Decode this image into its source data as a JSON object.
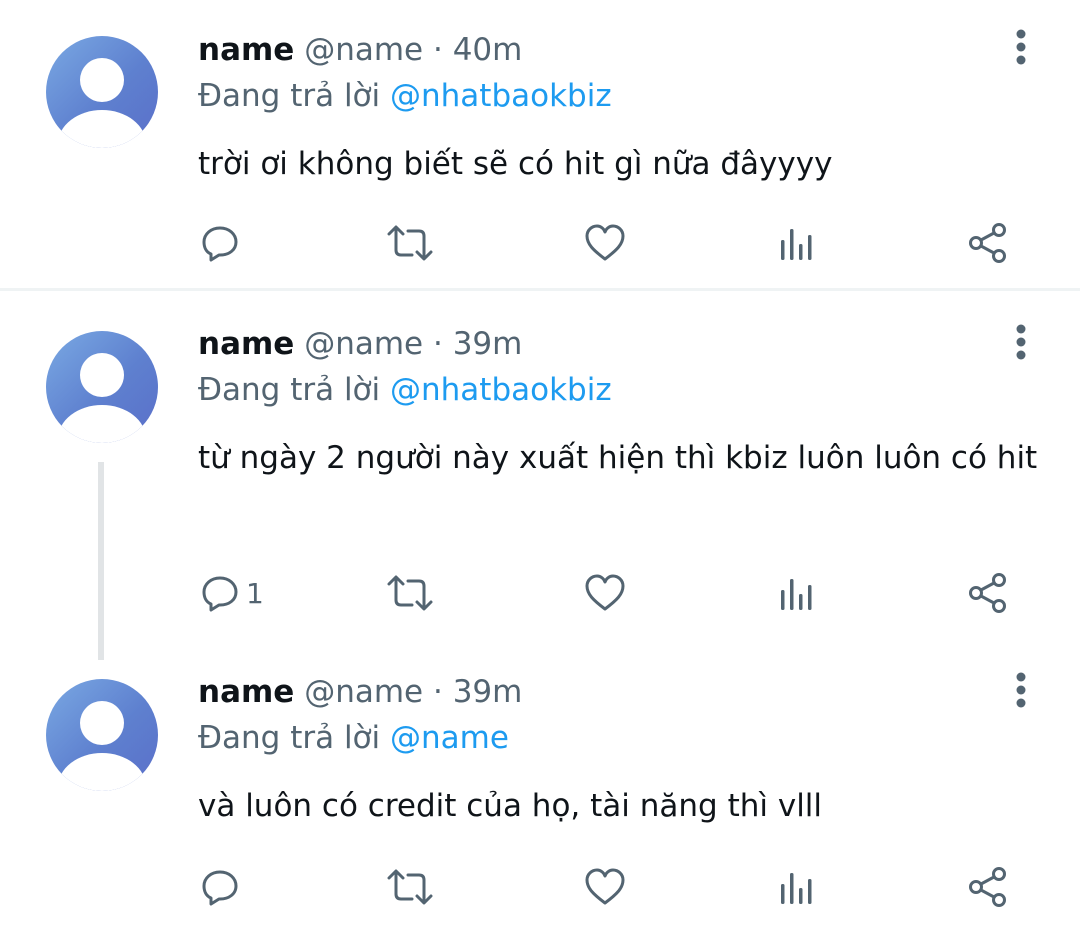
{
  "tweets": [
    {
      "display_name": "name",
      "handle": "@name",
      "separator": "·",
      "time": "40m",
      "replying_prefix": "Đang trả lời",
      "replying_to": "@nhatbaokbiz",
      "text": "trời ơi không biết sẽ có hit gì nữa đâyyyy",
      "reply_count": ""
    },
    {
      "display_name": "name",
      "handle": "@name",
      "separator": "·",
      "time": "39m",
      "replying_prefix": "Đang trả lời",
      "replying_to": "@nhatbaokbiz",
      "text": "từ ngày 2 người này xuất hiện thì kbiz luôn luôn có hit",
      "reply_count": "1"
    },
    {
      "display_name": "name",
      "handle": "@name",
      "separator": "·",
      "time": "39m",
      "replying_prefix": "Đang trả lời",
      "replying_to": "@name",
      "text": "và luôn có credit của họ, tài năng thì vlll",
      "reply_count": ""
    }
  ],
  "icons": {
    "reply": "reply-icon",
    "retweet": "retweet-icon",
    "like": "like-icon",
    "views": "views-icon",
    "share": "share-icon",
    "more": "more-icon",
    "avatar": "avatar-placeholder-icon"
  },
  "colors": {
    "text": "#0f1419",
    "secondary": "#536471",
    "link": "#1d9bf0",
    "avatar": "#5e80cf"
  }
}
